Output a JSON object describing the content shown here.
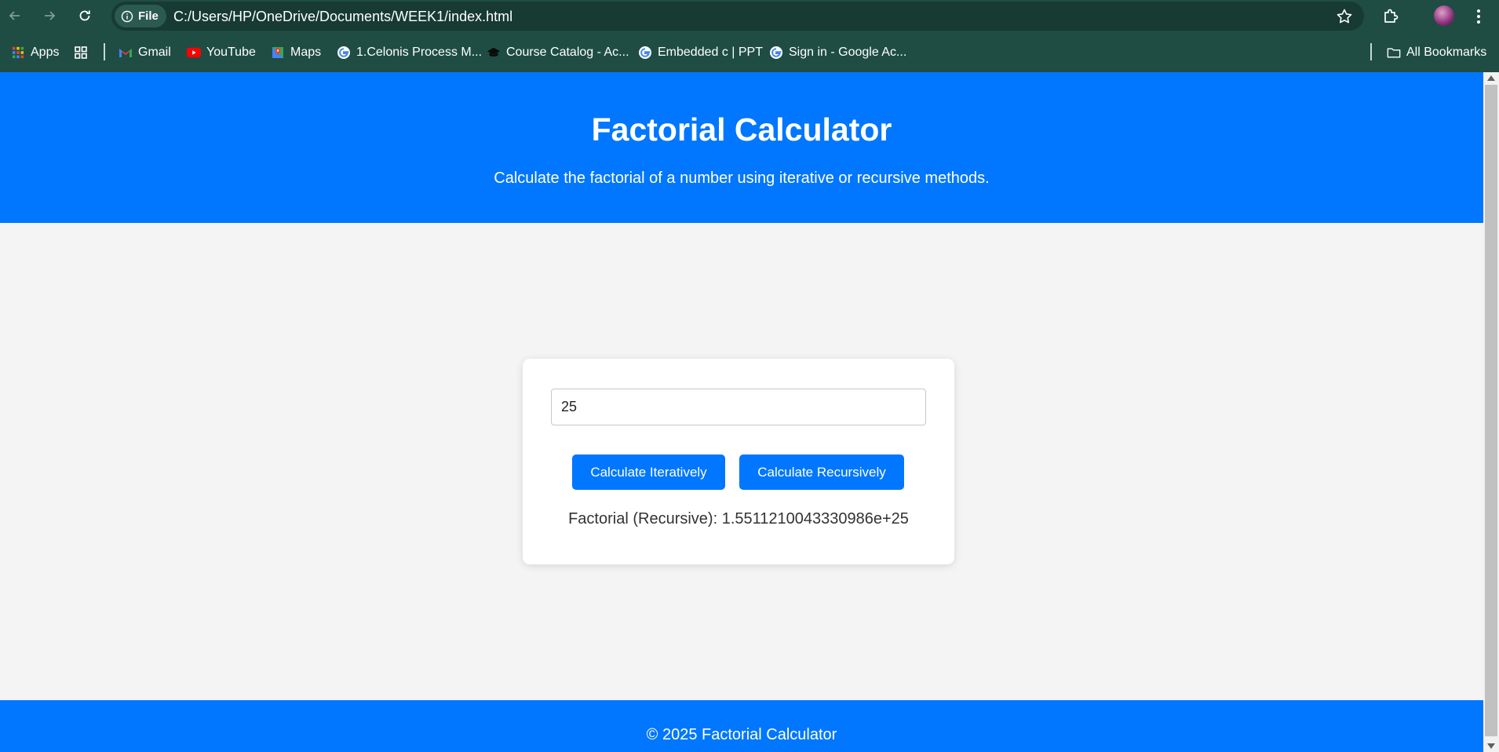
{
  "browser": {
    "url": "C:/Users/HP/OneDrive/Documents/WEEK1/index.html",
    "file_chip_label": "File",
    "bookmarks": [
      {
        "label": "Apps",
        "icon": "apps-grid-icon"
      },
      {
        "label": "Gmail",
        "icon": "gmail-icon"
      },
      {
        "label": "YouTube",
        "icon": "youtube-icon"
      },
      {
        "label": "Maps",
        "icon": "maps-icon"
      },
      {
        "label": "1.Celonis Process M...",
        "icon": "google-icon"
      },
      {
        "label": "Course Catalog - Ac...",
        "icon": "graduation-cap-icon"
      },
      {
        "label": "Embedded c | PPT",
        "icon": "google-icon"
      },
      {
        "label": "Sign in - Google Ac...",
        "icon": "google-icon"
      }
    ],
    "all_bookmarks_label": "All Bookmarks"
  },
  "page": {
    "title": "Factorial Calculator",
    "subtitle": "Calculate the factorial of a number using iterative or recursive methods.",
    "input_value": "25",
    "buttons": {
      "iterative": "Calculate Iteratively",
      "recursive": "Calculate Recursively"
    },
    "result": "Factorial (Recursive): 1.5511210043330986e+25",
    "footer": "© 2025 Factorial Calculator"
  },
  "colors": {
    "brand_blue": "#0077fe",
    "chrome_green": "#1f4d43",
    "page_bg": "#f4f4f4"
  }
}
